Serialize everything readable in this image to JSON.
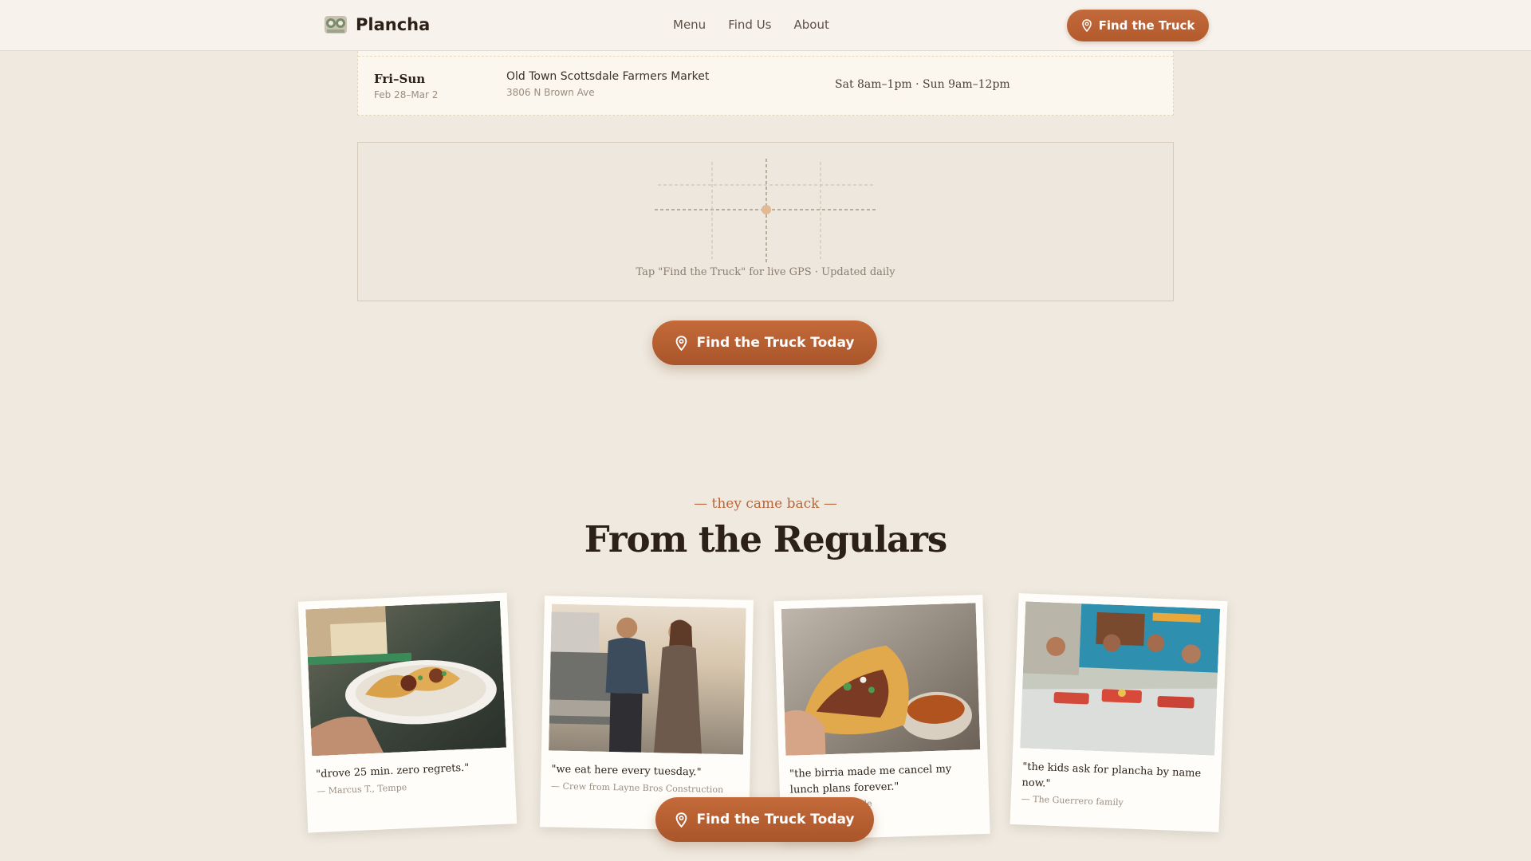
{
  "header": {
    "brand": "Plancha",
    "nav": [
      "Menu",
      "Find Us",
      "About"
    ],
    "cta": "Find the Truck"
  },
  "schedule_row": {
    "day": "Fri–Sun",
    "dates": "Feb 28–Mar 2",
    "venue": "Old Town Scottsdale Farmers Market",
    "address": "3806 N Brown Ave",
    "hours": "Sat 8am–1pm · Sun 9am–12pm"
  },
  "map": {
    "caption": "Tap \"Find the Truck\" for live GPS · Updated daily"
  },
  "cta_main": "Find the Truck Today",
  "testimonials": {
    "eyebrow": "— they came back —",
    "title": "From the Regulars",
    "items": [
      {
        "quote": "\"drove 25 min. zero regrets.\"",
        "author": "— Marcus T., Tempe"
      },
      {
        "quote": "\"we eat here every tuesday.\"",
        "author": "— Crew from Layne Bros Construction"
      },
      {
        "quote": "\"the birria made me cancel my lunch plans forever.\"",
        "author": "— J. R., Scottsdale"
      },
      {
        "quote": "\"the kids ask for plancha by name now.\"",
        "author": "— The Guerrero family"
      }
    ]
  },
  "cta_floating": "Find the Truck Today",
  "colors": {
    "accent": "#b85f30",
    "background": "#efe9df",
    "header": "#f7f2ec"
  }
}
